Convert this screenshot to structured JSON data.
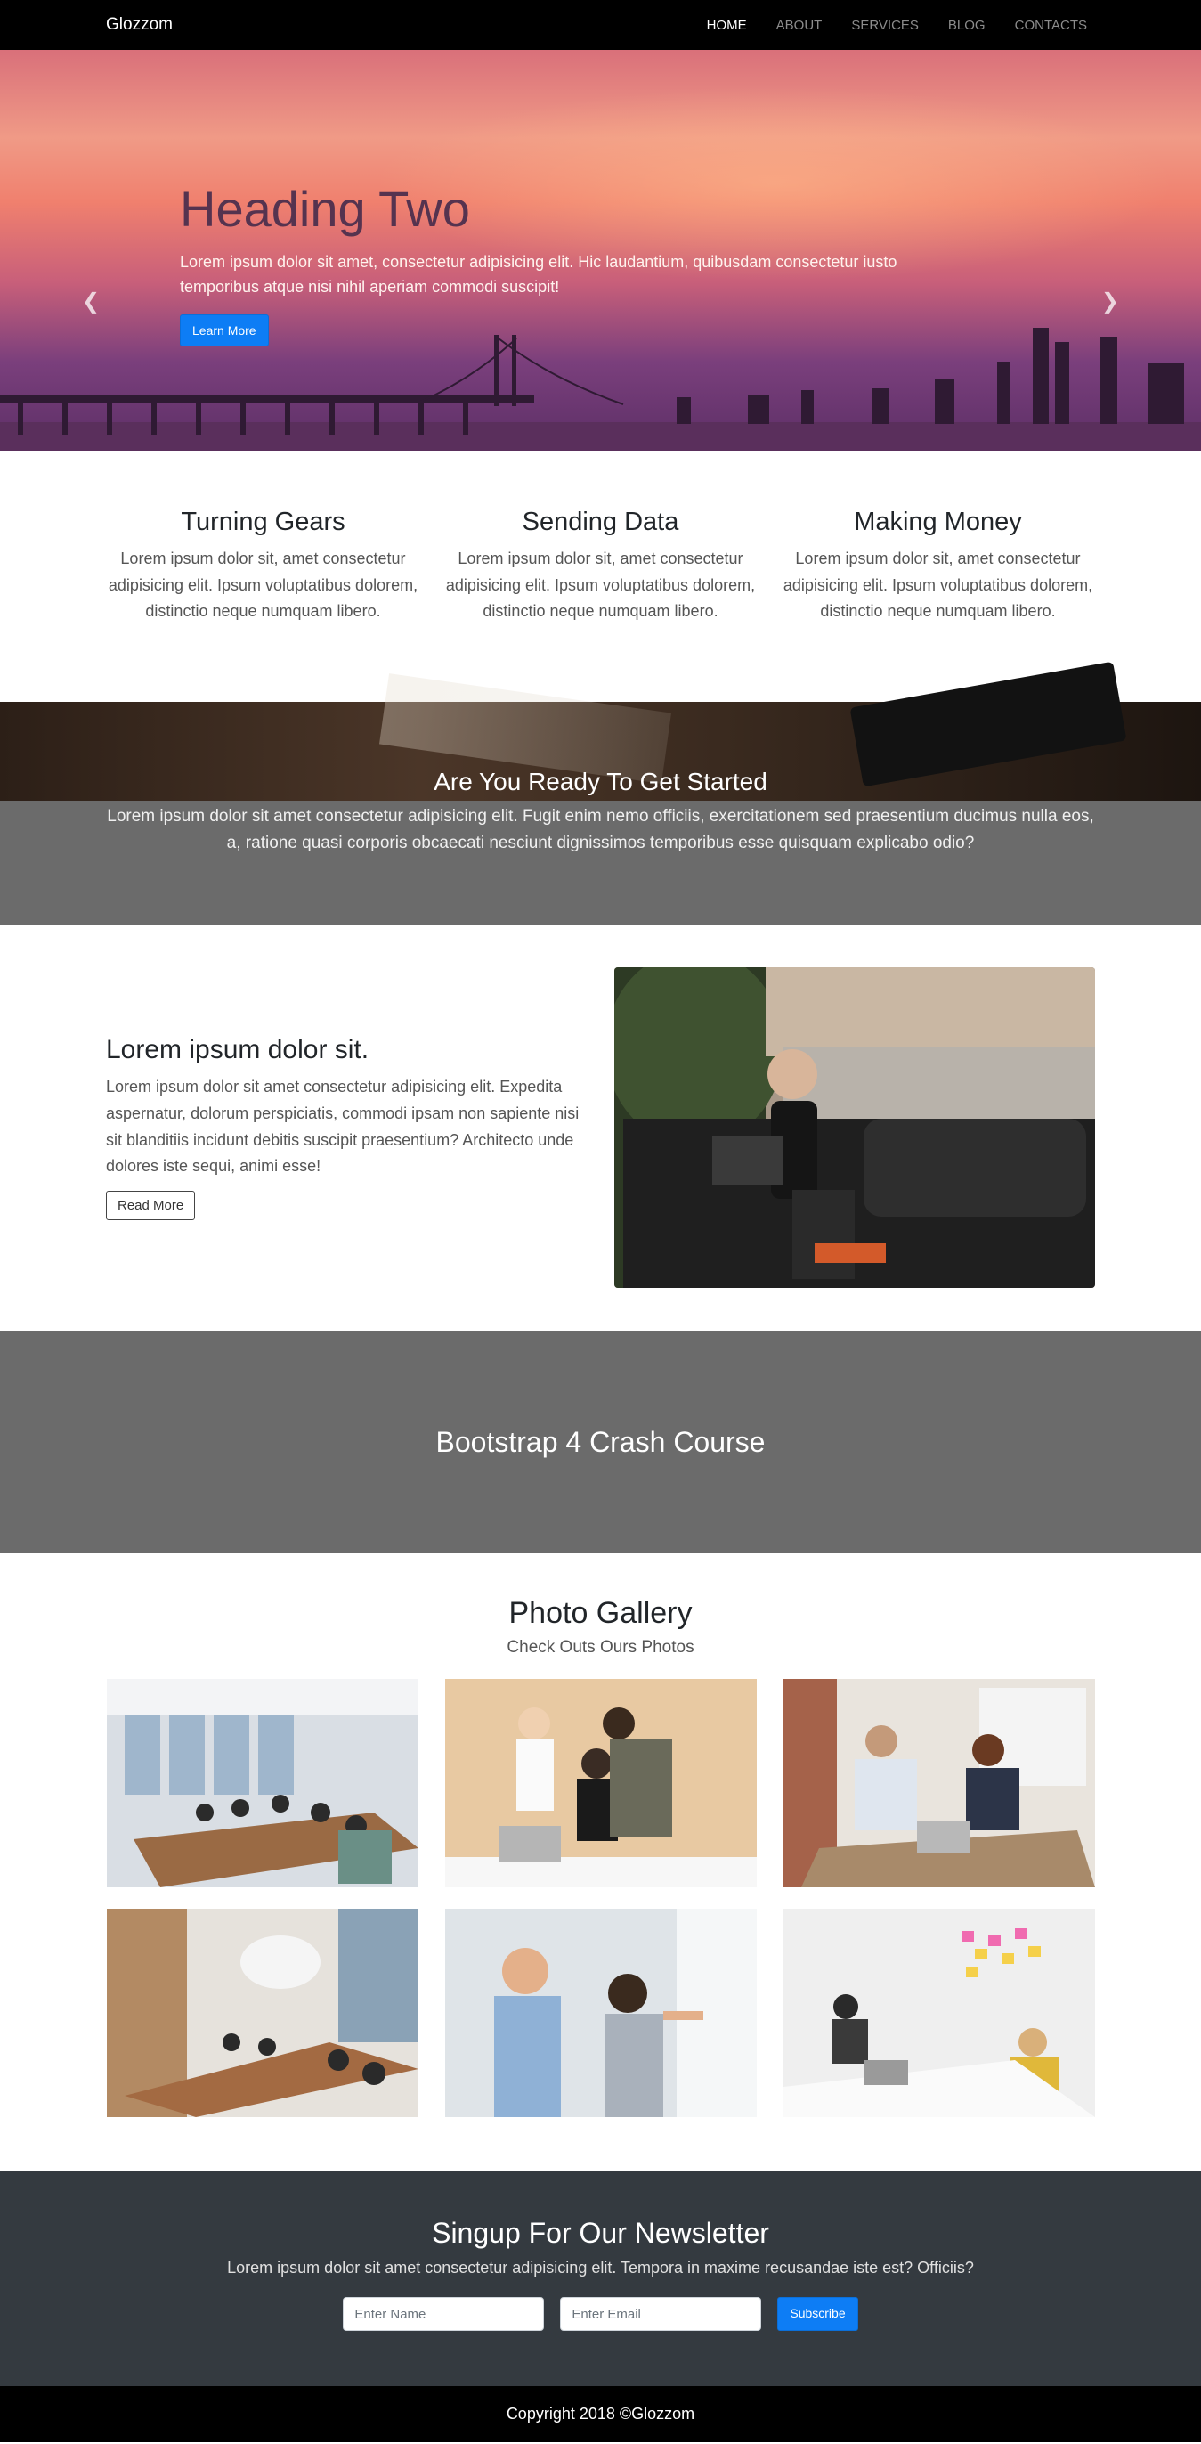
{
  "navbar": {
    "brand": "Glozzom",
    "items": [
      {
        "label": "HOME"
      },
      {
        "label": "ABOUT"
      },
      {
        "label": "SERVICES"
      },
      {
        "label": "BLOG"
      },
      {
        "label": "CONTACTS"
      }
    ],
    "active_index": 0
  },
  "hero": {
    "heading": "Heading Two",
    "text": "Lorem ipsum dolor sit amet, consectetur adipisicing elit. Hic laudantium, quibusdam consectetur iusto temporibus atque nisi nihil aperiam commodi suscipit!",
    "button_label": "Learn More",
    "prev_icon": "chevron-left-icon",
    "next_icon": "chevron-right-icon",
    "slide_count": 3,
    "active_slide": 3
  },
  "features": [
    {
      "title": "Turning Gears",
      "text": "Lorem ipsum dolor sit, amet consectetur adipisicing elit. Ipsum voluptatibus dolorem, distinctio neque numquam libero."
    },
    {
      "title": "Sending Data",
      "text": "Lorem ipsum dolor sit, amet consectetur adipisicing elit. Ipsum voluptatibus dolorem, distinctio neque numquam libero."
    },
    {
      "title": "Making Money",
      "text": "Lorem ipsum dolor sit, amet consectetur adipisicing elit. Ipsum voluptatibus dolorem, distinctio neque numquam libero."
    }
  ],
  "ready": {
    "title": "Are You Ready To Get Started",
    "text": "Lorem ipsum dolor sit amet consectetur adipisicing elit. Fugit enim nemo officiis, exercitationem sed praesentium ducimus nulla eos, a, ratione quasi corporis obcaecati nesciunt dignissimos temporibus esse quisquam explicabo odio?"
  },
  "about": {
    "title": "Lorem ipsum dolor sit.",
    "text": "Lorem ipsum dolor sit amet consectetur adipisicing elit. Expedita aspernatur, dolorum perspiciatis, commodi ipsam non sapiente nisi sit blanditiis incidunt debitis suscipit praesentium? Architecto unde dolores iste sequi, animi esse!",
    "button_label": "Read More"
  },
  "crash": {
    "title": "Bootstrap 4 Crash Course"
  },
  "gallery": {
    "title": "Photo Gallery",
    "subtitle": "Check Outs Ours Photos",
    "photos": [
      "meeting-room-photo",
      "team-laptop-photo",
      "high-five-photo",
      "conference-table-photo",
      "whiteboard-photo",
      "sticky-notes-photo"
    ]
  },
  "newsletter": {
    "title": "Singup For Our Newsletter",
    "text": "Lorem ipsum dolor sit amet consectetur adipisicing elit. Tempora in maxime recusandae iste est? Officiis?",
    "name_placeholder": "Enter Name",
    "email_placeholder": "Enter Email",
    "button_label": "Subscribe"
  },
  "footer": {
    "text": "Copyright 2018 ©Glozzom"
  },
  "colors": {
    "primary": "#0d7df5",
    "navbar": "#000000",
    "section_gray": "#6b6b6b",
    "newsletter_bg": "#343a40"
  }
}
